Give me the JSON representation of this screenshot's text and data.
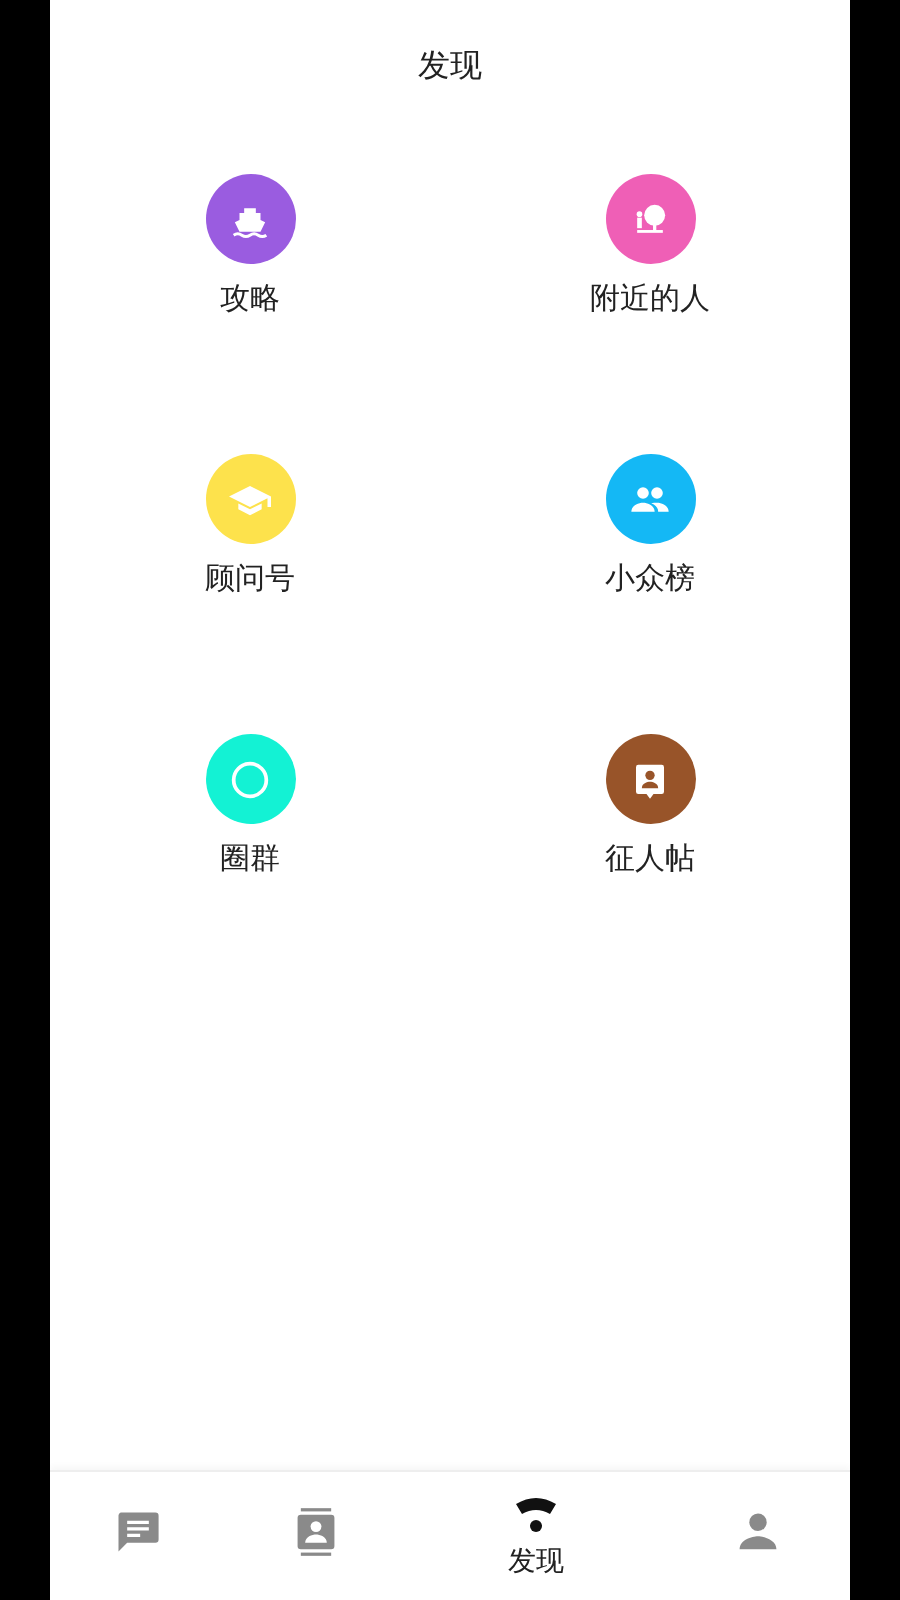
{
  "header": {
    "title": "发现"
  },
  "items": [
    {
      "kind": "ship",
      "label": "攻略",
      "color": "#9a5ce0"
    },
    {
      "kind": "tree",
      "label": "附近的人",
      "color": "#ef5fb6"
    },
    {
      "kind": "cap",
      "label": "顾问号",
      "color": "#fde24c"
    },
    {
      "kind": "people",
      "label": "小众榜",
      "color": "#14b8f5"
    },
    {
      "kind": "ring",
      "label": "圈群",
      "color": "#13f2d4"
    },
    {
      "kind": "badge",
      "label": "征人帖",
      "color": "#985429"
    }
  ],
  "tab_bar": [
    {
      "kind": "chat",
      "selected": false
    },
    {
      "kind": "contacts",
      "selected": false
    },
    {
      "kind": "discover",
      "selected": true,
      "label": "发现"
    },
    {
      "kind": "me",
      "selected": false
    }
  ]
}
